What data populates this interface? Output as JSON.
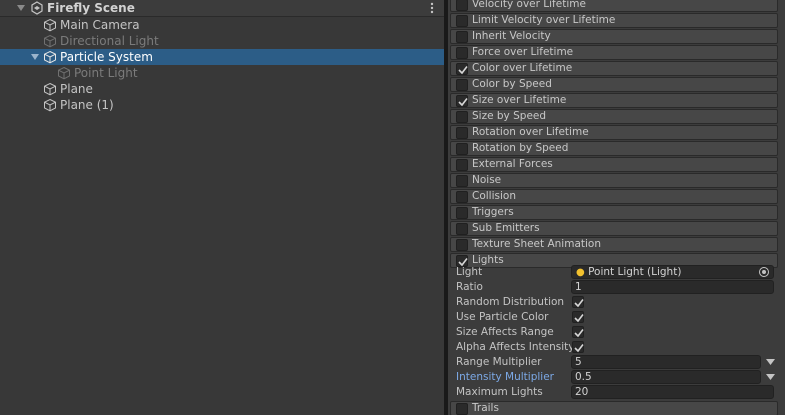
{
  "hierarchy": {
    "scene_title": "Firefly Scene",
    "items": [
      {
        "label": "Main Camera"
      },
      {
        "label": "Directional Light"
      },
      {
        "label": "Particle System"
      },
      {
        "label": "Point Light"
      },
      {
        "label": "Plane"
      },
      {
        "label": "Plane (1)"
      }
    ]
  },
  "inspector": {
    "modules": [
      {
        "label": "Velocity over Lifetime",
        "enabled": false
      },
      {
        "label": "Limit Velocity over Lifetime",
        "enabled": false
      },
      {
        "label": "Inherit Velocity",
        "enabled": false
      },
      {
        "label": "Force over Lifetime",
        "enabled": false
      },
      {
        "label": "Color over Lifetime",
        "enabled": true
      },
      {
        "label": "Color by Speed",
        "enabled": false
      },
      {
        "label": "Size over Lifetime",
        "enabled": true
      },
      {
        "label": "Size by Speed",
        "enabled": false
      },
      {
        "label": "Rotation over Lifetime",
        "enabled": false
      },
      {
        "label": "Rotation by Speed",
        "enabled": false
      },
      {
        "label": "External Forces",
        "enabled": false
      },
      {
        "label": "Noise",
        "enabled": false
      },
      {
        "label": "Collision",
        "enabled": false
      },
      {
        "label": "Triggers",
        "enabled": false
      },
      {
        "label": "Sub Emitters",
        "enabled": false
      },
      {
        "label": "Texture Sheet Animation",
        "enabled": false
      },
      {
        "label": "Lights",
        "enabled": true
      }
    ],
    "lights": {
      "light_label": "Light",
      "light_value": "Point Light (Light)",
      "ratio_label": "Ratio",
      "ratio_value": "1",
      "random_distribution_label": "Random Distribution",
      "random_distribution": true,
      "use_particle_color_label": "Use Particle Color",
      "use_particle_color": true,
      "size_affects_range_label": "Size Affects Range",
      "size_affects_range": true,
      "alpha_affects_intensity_label": "Alpha Affects Intensity",
      "alpha_affects_intensity": true,
      "range_multiplier_label": "Range Multiplier",
      "range_multiplier_value": "5",
      "intensity_multiplier_label": "Intensity Multiplier",
      "intensity_multiplier_value": "0.5",
      "maximum_lights_label": "Maximum Lights",
      "maximum_lights_value": "20"
    },
    "trails": {
      "label": "Trails",
      "enabled": false
    }
  },
  "colors": {
    "selection": "#2c5d87",
    "accent_label": "#7ca9e6",
    "light_icon": "#f2c12e"
  }
}
